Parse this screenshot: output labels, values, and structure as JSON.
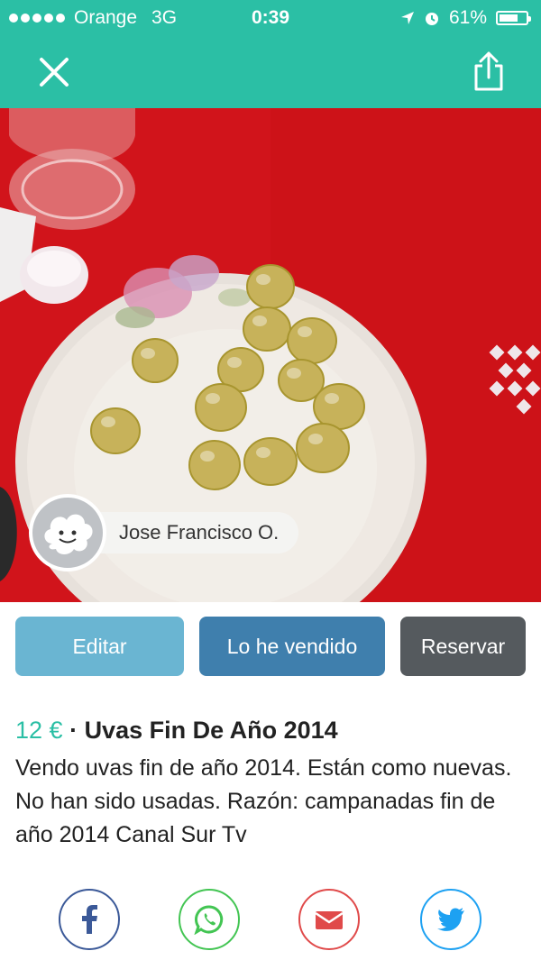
{
  "status_bar": {
    "carrier": "Orange",
    "network": "3G",
    "time": "0:39",
    "battery": "61%"
  },
  "nav": {
    "close_icon": "close-icon",
    "share_icon": "share-icon"
  },
  "seller": {
    "name": "Jose Francisco O."
  },
  "actions": {
    "edit_label": "Editar",
    "sold_label": "Lo he vendido",
    "reserve_label": "Reservar"
  },
  "listing": {
    "price": "12 €",
    "separator": " · ",
    "title": "Uvas Fin De Año 2014",
    "description": "Vendo uvas fin de año 2014. Están como nuevas. No han sido usadas. Razón: campanadas fin de año 2014 Canal Sur Tv"
  },
  "share": {
    "facebook_color": "#3b5998",
    "whatsapp_color": "#43c553",
    "email_color": "#e04a4a",
    "twitter_color": "#1da1f2"
  },
  "colors": {
    "brand": "#2bbfa5",
    "edit_button": "#6ab5d2",
    "sold_button": "#3f7fad",
    "reserve_button": "#555a5e"
  }
}
